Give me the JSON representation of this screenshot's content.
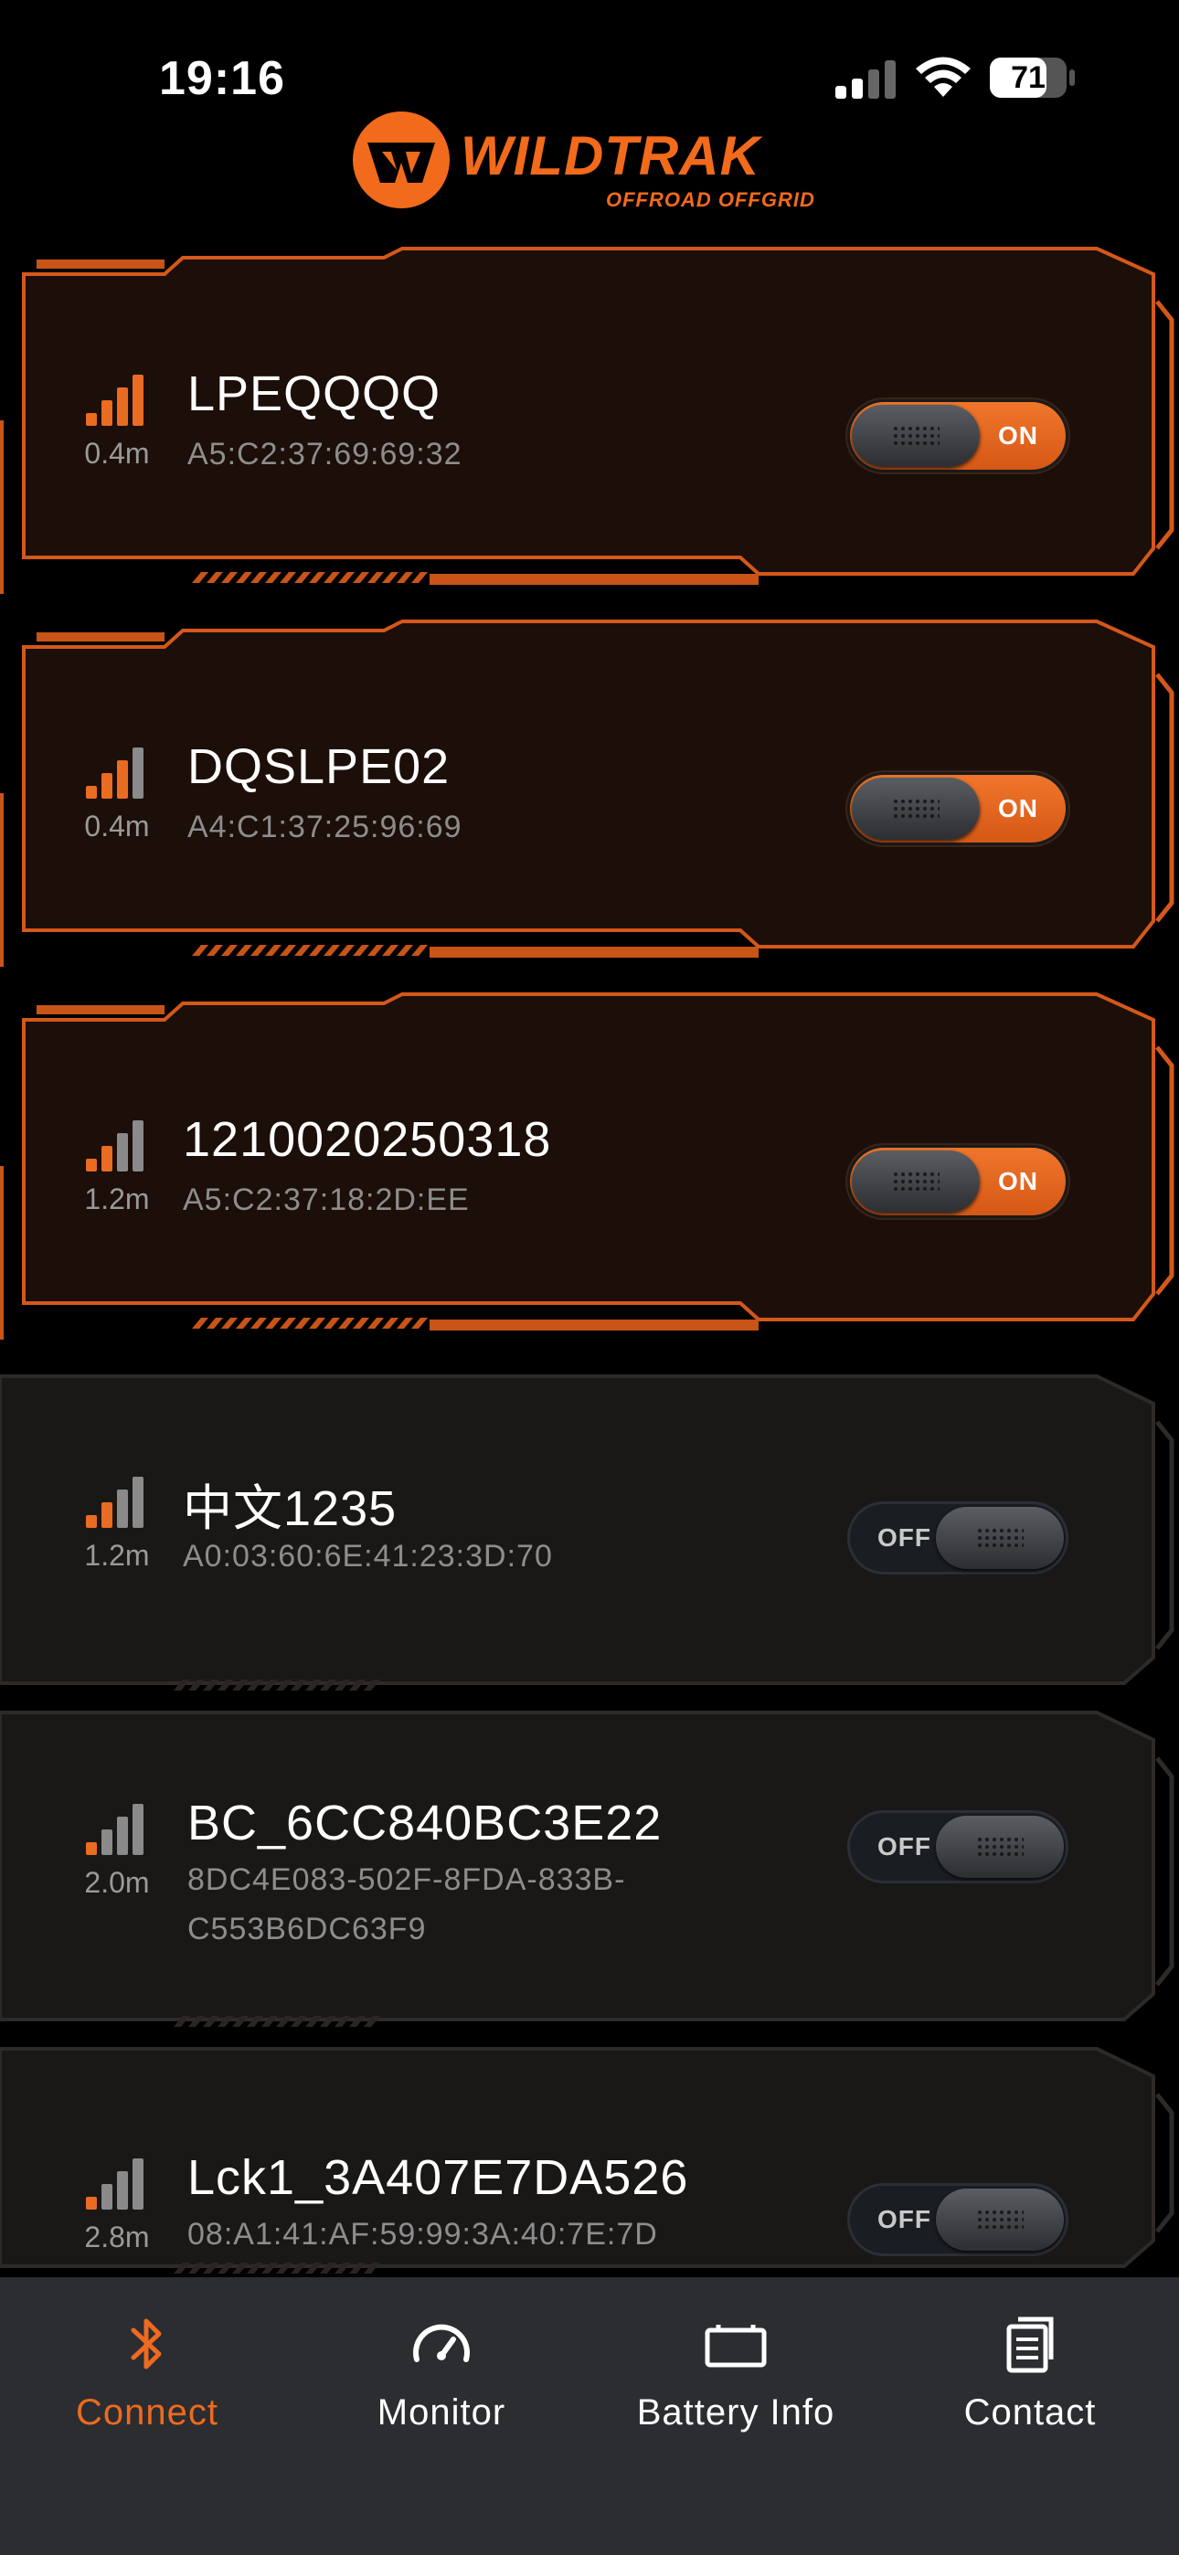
{
  "status_bar": {
    "time": "19:16",
    "battery": "71"
  },
  "logo": {
    "name": "WILDTRAK",
    "tagline": "OFFROAD OFFGRID"
  },
  "colors": {
    "accent": "#ee6a1f",
    "background": "#000000",
    "tab_bar": "#2b2d31"
  },
  "devices": [
    {
      "name": "LPEQQQQ",
      "id": "A5:C2:37:69:69:32",
      "distance": "0.4m",
      "signal_bars": 4,
      "toggle": "ON",
      "connected": true
    },
    {
      "name": "DQSLPE02",
      "id": "A4:C1:37:25:96:69",
      "distance": "0.4m",
      "signal_bars": 3,
      "toggle": "ON",
      "connected": true
    },
    {
      "name": "1210020250318",
      "id": "A5:C2:37:18:2D:EE",
      "distance": "1.2m",
      "signal_bars": 2,
      "toggle": "ON",
      "connected": true
    },
    {
      "name": "中文1235",
      "id": "A0:03:60:6E:41:23:3D:70",
      "distance": "1.2m",
      "signal_bars": 2,
      "toggle": "OFF",
      "connected": false
    },
    {
      "name": "BC_6CC840BC3E22",
      "id": "8DC4E083-502F-8FDA-833B-C553B6DC63F9",
      "distance": "2.0m",
      "signal_bars": 1,
      "toggle": "OFF",
      "connected": false
    },
    {
      "name": "Lck1_3A407E7DA526",
      "id": "08:A1:41:AF:59:99:3A:40:7E:7D",
      "distance": "2.8m",
      "signal_bars": 1,
      "toggle": "OFF",
      "connected": false
    }
  ],
  "tabs": [
    {
      "label": "Connect",
      "icon": "bluetooth-icon",
      "active": true
    },
    {
      "label": "Monitor",
      "icon": "gauge-icon",
      "active": false
    },
    {
      "label": "Battery Info",
      "icon": "battery-icon",
      "active": false
    },
    {
      "label": "Contact",
      "icon": "document-icon",
      "active": false
    }
  ]
}
